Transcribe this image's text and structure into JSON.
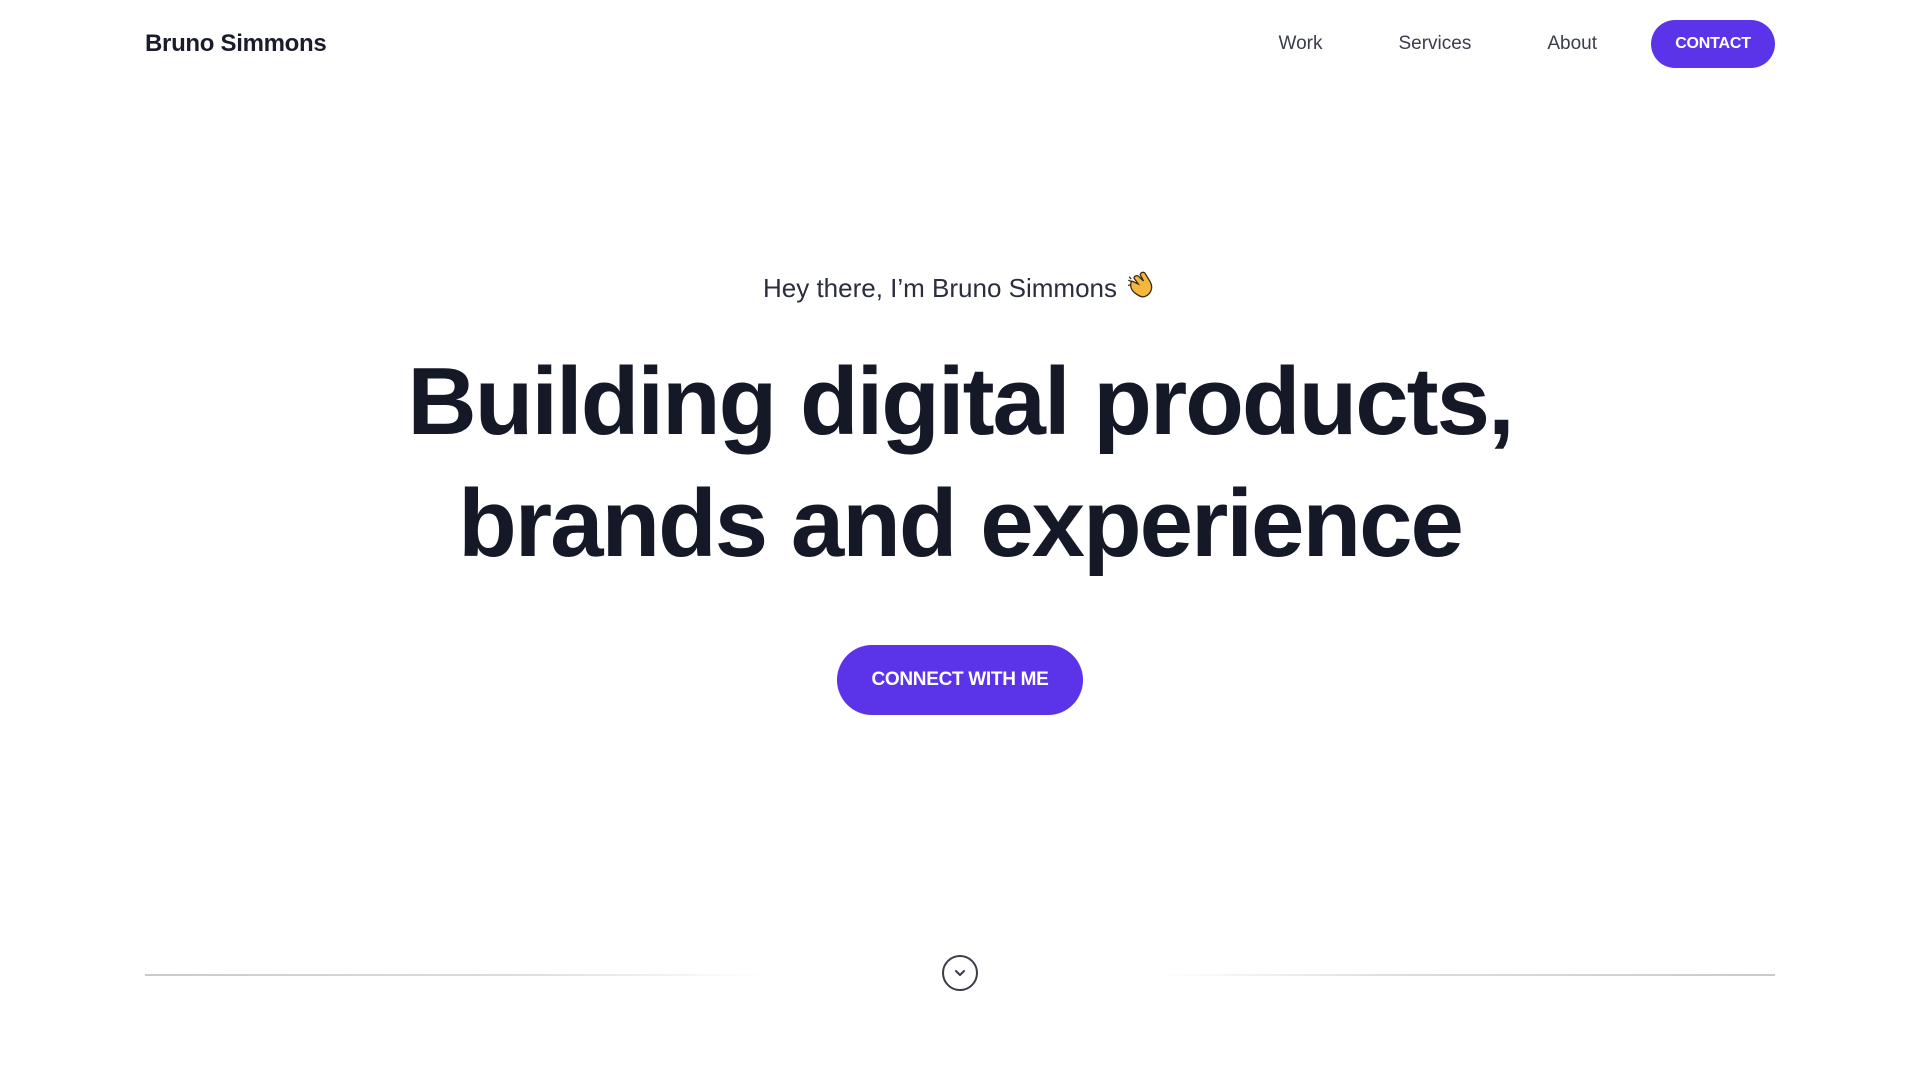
{
  "brand": {
    "name": "Bruno Simmons",
    "accent_color": "#5b34ea"
  },
  "nav": {
    "items": [
      {
        "label": "Work"
      },
      {
        "label": "Services"
      },
      {
        "label": "About"
      }
    ],
    "contact_label": "CONTACT"
  },
  "hero": {
    "greeting": "Hey there, I’m Bruno Simmons",
    "greeting_icon": "clapping-hands-icon",
    "headline_line1": "Building digital products,",
    "headline_line2": "brands and experience",
    "cta_label": "CONNECT WITH ME"
  },
  "footer": {
    "scroll_icon": "chevron-down-icon"
  }
}
